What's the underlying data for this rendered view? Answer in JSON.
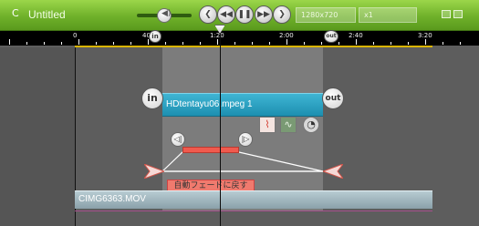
{
  "titlebar": {
    "title": "Untitled",
    "resolution": "1280x720",
    "zoom": "x1",
    "icons": [
      "app-icon",
      "volume-icon",
      "rewind-icon",
      "step-back-icon",
      "pause-icon",
      "step-forward-icon",
      "forward-icon",
      "fullscreen-icon",
      "window-icon"
    ],
    "accent": "#7cc033"
  },
  "ruler": {
    "labels": [
      "0",
      "40",
      "1:20",
      "2:00",
      "2:40",
      "3:20"
    ]
  },
  "markers": {
    "in_label": "in",
    "out_label": "out"
  },
  "clips": {
    "video_name": "HDtentayu06.mpeg 1",
    "audio_name": "CIMG6363.MOV"
  },
  "tools": {
    "fade_reset_label": "自動フェードに戻す"
  }
}
